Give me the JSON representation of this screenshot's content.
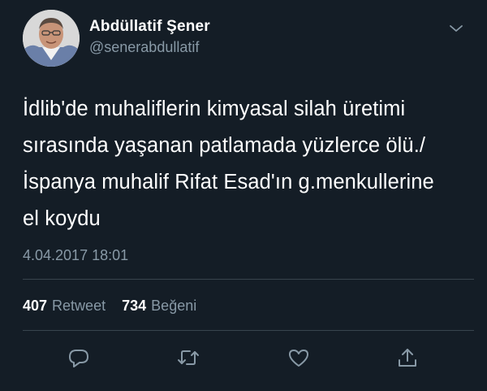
{
  "author": {
    "display_name": "Abdüllatif Şener",
    "handle": "@senerabdullatif"
  },
  "tweet": {
    "text": "İdlib'de muhaliflerin kimyasal silah üretimi\nsırasında yaşanan patlamada yüzlerce ölü./\nİspanya muhalif Rifat Esad'ın g.menkullerine\nel koydu",
    "timestamp": "4.04.2017 18:01"
  },
  "stats": {
    "retweet_count": "407",
    "retweet_label": "Retweet",
    "like_count": "734",
    "like_label": "Beğeni"
  },
  "actions": {
    "reply_icon": "reply-icon",
    "retweet_icon": "retweet-icon",
    "like_icon": "heart-icon",
    "share_icon": "share-icon"
  },
  "colors": {
    "background": "#141d26",
    "secondary_text": "#8899a6",
    "divider": "#38444d",
    "primary_text": "#ffffff"
  }
}
